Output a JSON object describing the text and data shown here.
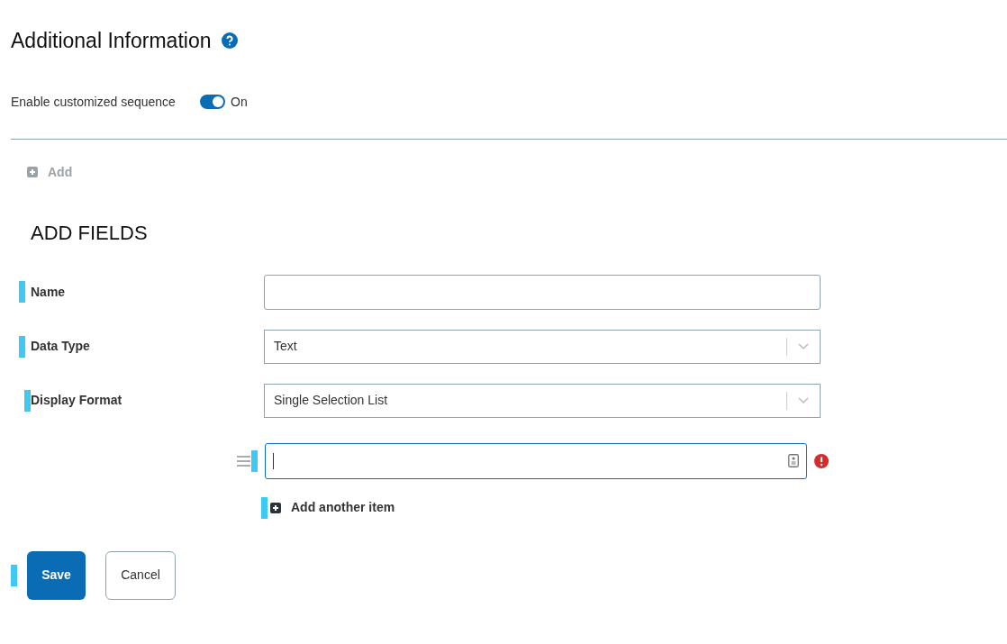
{
  "title": "Additional Information",
  "toggle": {
    "label": "Enable customized sequence",
    "on": true,
    "state_text": "On"
  },
  "add_link": "Add",
  "section_title": "ADD FIELDS",
  "fields": [
    {
      "label": "Name",
      "kind": "text",
      "required": true
    },
    {
      "label": "Data Type",
      "kind": "select",
      "value": "Text",
      "required": true
    },
    {
      "label": "Display Format",
      "kind": "select",
      "value": "Single Selection List",
      "required": true
    }
  ],
  "list_item": {
    "error": true,
    "focused": true
  },
  "add_item": "Add another item",
  "buttons": [
    {
      "label": "Save",
      "kind": "primary"
    },
    {
      "label": "Cancel",
      "kind": "secondary"
    }
  ]
}
